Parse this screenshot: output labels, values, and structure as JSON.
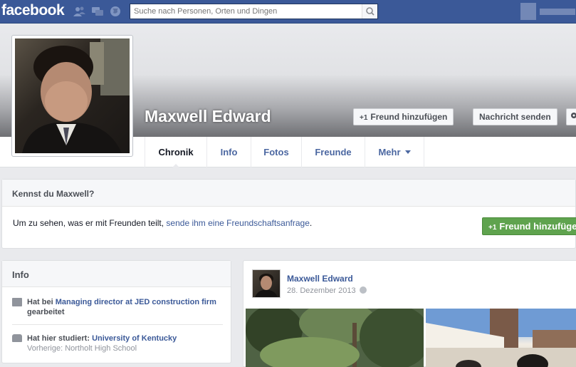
{
  "topbar": {
    "logo": "facebook",
    "search_placeholder": "Suche nach Personen, Orten und Dingen"
  },
  "profile": {
    "name": "Maxwell Edward",
    "add_friend_label": "Freund hinzufügen",
    "message_label": "Nachricht senden",
    "plus_glyph": "+1"
  },
  "tabs": [
    {
      "label": "Chronik"
    },
    {
      "label": "Info"
    },
    {
      "label": "Fotos"
    },
    {
      "label": "Freunde"
    },
    {
      "label": "Mehr"
    }
  ],
  "know_box": {
    "title": "Kennst du Maxwell?",
    "text_prefix": "Um zu sehen, was er mit Freunden teilt, ",
    "link": "sende ihm eine Freundschaftsanfrage",
    "text_suffix": ".",
    "button_label": "Freund hinzufügen"
  },
  "info_box": {
    "title": "Info",
    "work_prefix": "Hat bei ",
    "work_link": "Managing director at JED construction firm",
    "work_suffix": " gearbeitet",
    "study_prefix": "Hat hier studiert: ",
    "study_link": "University of Kentucky",
    "study_previous": "Vorherige: Northolt High School"
  },
  "post": {
    "author": "Maxwell Edward",
    "date": "28. Dezember 2013"
  },
  "colors": {
    "brand_blue": "#3b5998",
    "green_button": "#5fa34e"
  }
}
